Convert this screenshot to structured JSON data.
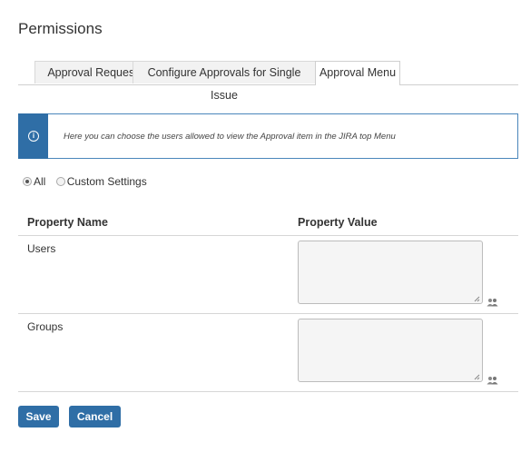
{
  "page": {
    "title": "Permissions"
  },
  "tabs": [
    {
      "label": "Approval Request",
      "active": false
    },
    {
      "label": "Configure Approvals for Single Issue",
      "active": false
    },
    {
      "label": "Approval Menu",
      "active": true
    }
  ],
  "info": {
    "icon": "info-icon",
    "text": "Here you can choose the users allowed to view the Approval item in the JIRA top Menu"
  },
  "visibility": {
    "options": [
      {
        "label": "All",
        "checked": true
      },
      {
        "label": "Custom Settings",
        "checked": false
      }
    ]
  },
  "table": {
    "headers": {
      "name": "Property Name",
      "value": "Property Value"
    },
    "rows": [
      {
        "name": "Users",
        "value": "",
        "picker_icon": "users-picker-icon"
      },
      {
        "name": "Groups",
        "value": "",
        "picker_icon": "groups-picker-icon"
      }
    ]
  },
  "actions": {
    "save": "Save",
    "cancel": "Cancel"
  },
  "colors": {
    "primary": "#2f6ea6",
    "info_border": "#4a86bb",
    "text": "#333333"
  }
}
